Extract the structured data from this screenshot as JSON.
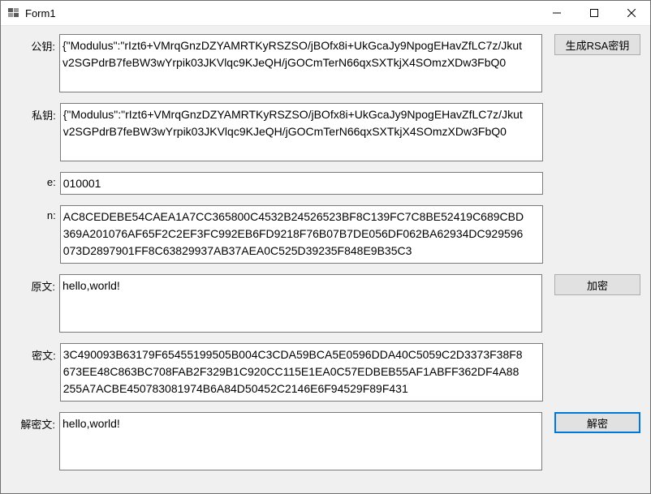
{
  "window": {
    "title": "Form1"
  },
  "labels": {
    "public_key": "公钥:",
    "private_key": "私钥:",
    "e": "e:",
    "n": "n:",
    "plaintext": "原文:",
    "ciphertext": "密文:",
    "decrypted": "解密文:"
  },
  "buttons": {
    "generate_rsa": "生成RSA密钥",
    "encrypt": "加密",
    "decrypt": "解密"
  },
  "values": {
    "public_key": "{\"Modulus\":\"rIzt6+VMrqGnzDZYAMRTKyRSZSO/jBOfx8i+UkGcaJy9NpogEHavZfLC7z/Jkutv2SGPdrB7feBW3wYrpik03JKVlqc9KJeQH/jGOCmTerN66qxSXTkjX4SOmzXDw3FbQ0",
    "private_key": "{\"Modulus\":\"rIzt6+VMrqGnzDZYAMRTKyRSZSO/jBOfx8i+UkGcaJy9NpogEHavZfLC7z/Jkutv2SGPdrB7feBW3wYrpik03JKVlqc9KJeQH/jGOCmTerN66qxSXTkjX4SOmzXDw3FbQ0",
    "e": "010001",
    "n": "AC8CEDEBE54CAEA1A7CC365800C4532B24526523BF8C139FC7C8BE52419C689CBD369A201076AF65F2C2EF3FC992EB6FD9218F76B07B7DE056DF062BA62934DC929596073D2897901FF8C63829937AB37AEA0C525D39235F848E9B35C3",
    "plaintext": "hello,world!",
    "ciphertext": "3C490093B63179F65455199505B004C3CDA59BCA5E0596DDA40C5059C2D3373F38F8673EE48C863BC708FAB2F329B1C920CC115E1EA0C57EDBEB55AF1ABFF362DF4A88255A7ACBE450783081974B6A84D50452C2146E6F94529F89F431",
    "decrypted": "hello,world!"
  }
}
